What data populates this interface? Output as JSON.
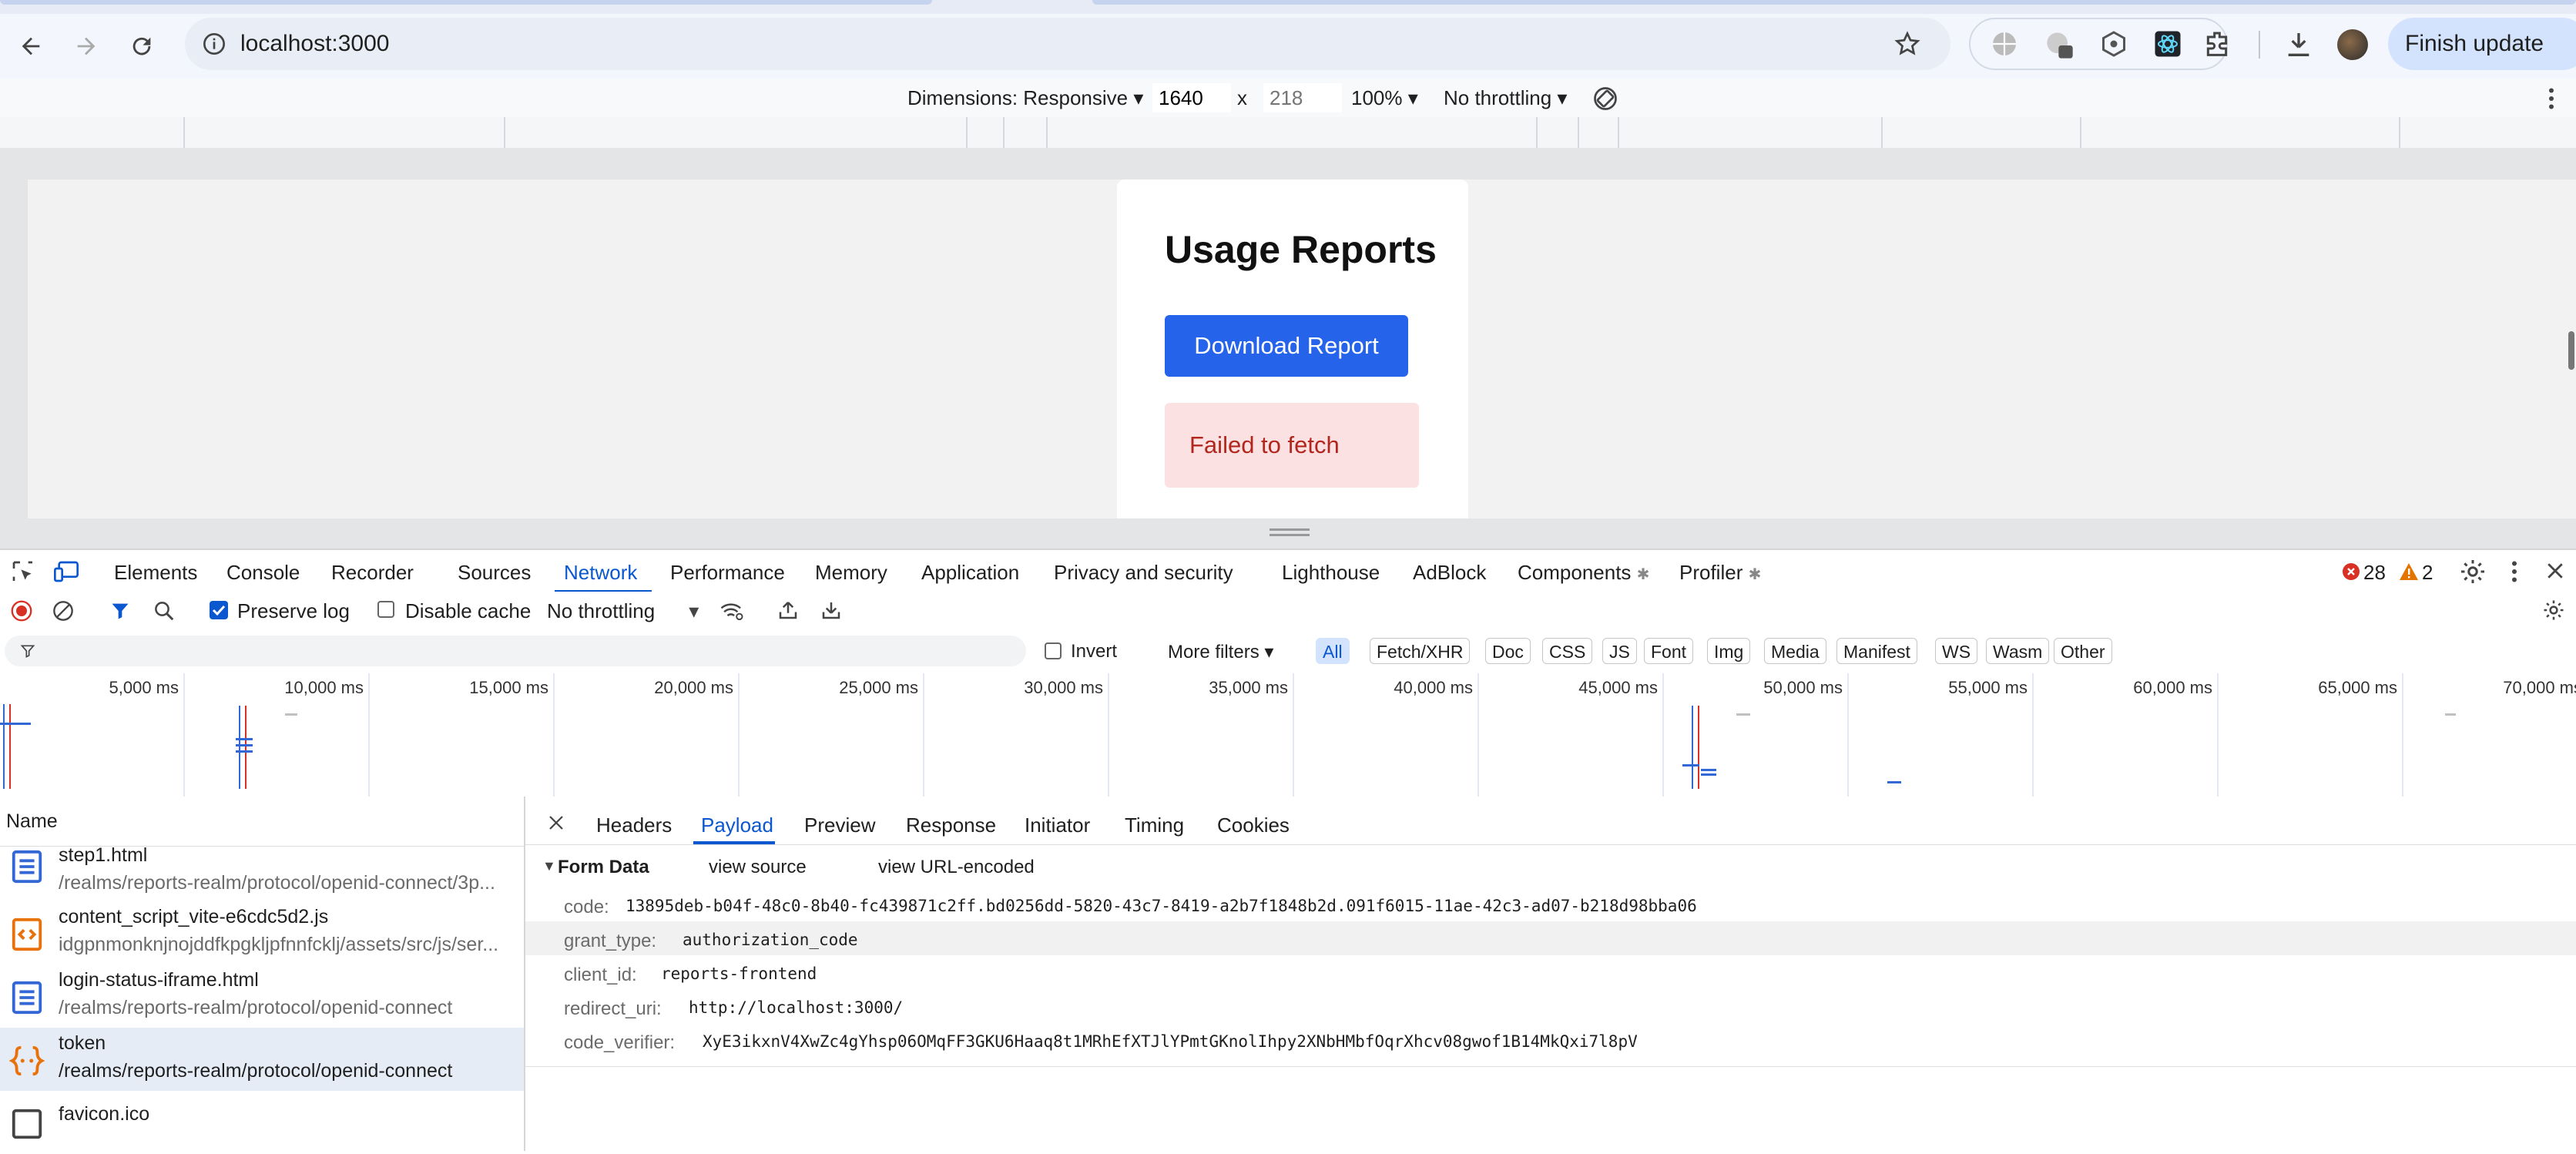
{
  "browser": {
    "url": "localhost:3000",
    "finish_update_label": "Finish update"
  },
  "device_toolbar": {
    "dimensions_label": "Dimensions: Responsive",
    "width_value": "1640",
    "times": "x",
    "height_placeholder": "218",
    "zoom": "100%",
    "throttling": "No throttling"
  },
  "page": {
    "heading": "Usage Reports",
    "download_button": "Download Report",
    "error_message": "Failed to fetch"
  },
  "devtools": {
    "tabs": [
      "Elements",
      "Console",
      "Recorder",
      "Sources",
      "Network",
      "Performance",
      "Memory",
      "Application",
      "Privacy and security",
      "Lighthouse",
      "AdBlock",
      "Components",
      "Profiler"
    ],
    "active_tab": "Network",
    "errors_count": "28",
    "warnings_count": "2",
    "network_toolbar": {
      "preserve_log": "Preserve log",
      "preserve_log_checked": true,
      "disable_cache": "Disable cache",
      "disable_cache_checked": false,
      "throttling": "No throttling"
    },
    "filter_row": {
      "invert": "Invert",
      "more_filters": "More filters",
      "types": [
        "All",
        "Fetch/XHR",
        "Doc",
        "CSS",
        "JS",
        "Font",
        "Img",
        "Media",
        "Manifest",
        "WS",
        "Wasm",
        "Other"
      ],
      "active_type": "All"
    },
    "timeline_labels": [
      "5,000 ms",
      "10,000 ms",
      "15,000 ms",
      "20,000 ms",
      "25,000 ms",
      "30,000 ms",
      "35,000 ms",
      "40,000 ms",
      "45,000 ms",
      "50,000 ms",
      "55,000 ms",
      "60,000 ms",
      "65,000 ms",
      "70,000 ms"
    ],
    "requests_header": "Name",
    "requests": [
      {
        "name": "step1.html",
        "path": "/realms/reports-realm/protocol/openid-connect/3p...",
        "icon": "document-icon",
        "selected": false
      },
      {
        "name": "content_script_vite-e6cdc5d2.js",
        "path": "idgpnmonknjnojddfkpgkljpfnnfcklj/assets/src/js/ser...",
        "icon": "script-icon",
        "selected": false
      },
      {
        "name": "login-status-iframe.html",
        "path": "/realms/reports-realm/protocol/openid-connect",
        "icon": "document-icon",
        "selected": false
      },
      {
        "name": "token",
        "path": "/realms/reports-realm/protocol/openid-connect",
        "icon": "fetch-icon",
        "selected": true
      },
      {
        "name": "favicon.ico",
        "path": "",
        "icon": "image-icon",
        "selected": false
      }
    ],
    "detail_tabs": [
      "Headers",
      "Payload",
      "Preview",
      "Response",
      "Initiator",
      "Timing",
      "Cookies"
    ],
    "active_detail_tab": "Payload",
    "form_data": {
      "title": "Form Data",
      "view_source": "view source",
      "view_url_encoded": "view URL-encoded",
      "fields": [
        {
          "key": "code:",
          "value": "13895deb-b04f-48c0-8b40-fc439871c2ff.bd0256dd-5820-43c7-8419-a2b7f1848b2d.091f6015-11ae-42c3-ad07-b218d98bba06"
        },
        {
          "key": "grant_type:",
          "value": "authorization_code"
        },
        {
          "key": "client_id:",
          "value": "reports-frontend"
        },
        {
          "key": "redirect_uri:",
          "value": "http://localhost:3000/"
        },
        {
          "key": "code_verifier:",
          "value": "XyE3ikxnV4XwZc4gYhsp06OMqFF3GKU6Haaq8t1MRhEfXTJlYPmtGKnolIhpy2XNbHMbfOqrXhcv08gwof1B14MkQxi7l8pV"
        }
      ]
    }
  },
  "colors": {
    "accent_blue": "#0b57d0",
    "button_blue": "#2563eb",
    "error_bg": "#fbe1e1",
    "error_text": "#b3261e",
    "record_red": "#d93025"
  }
}
